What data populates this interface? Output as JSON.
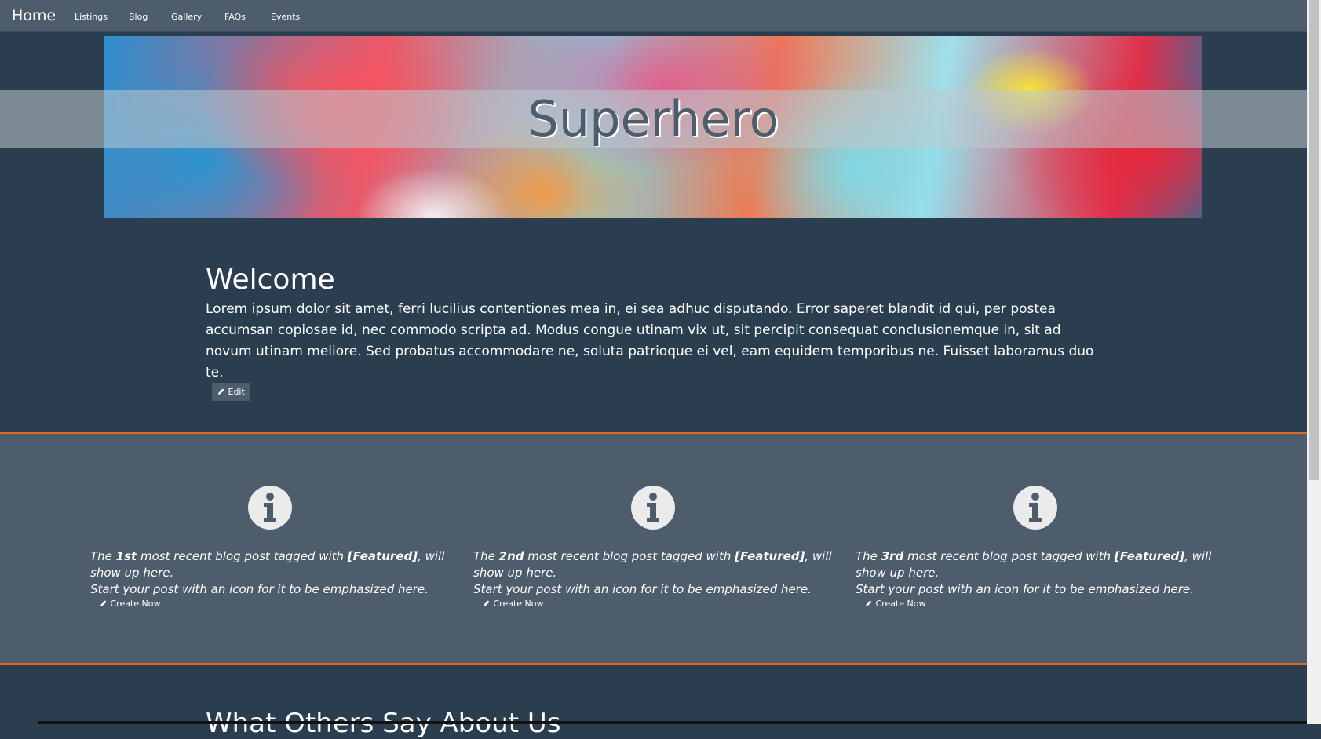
{
  "nav": {
    "brand": "Home",
    "items": [
      {
        "label": "Listings"
      },
      {
        "label": "Blog"
      },
      {
        "label": "Gallery"
      },
      {
        "label": "FAQs"
      },
      {
        "label": "Events"
      }
    ]
  },
  "hero": {
    "title": "Superhero"
  },
  "welcome": {
    "title": "Welcome",
    "body": "Lorem ipsum dolor sit amet, ferri lucilius contentiones mea in, ei sea adhuc disputando. Error saperet blandit id qui, per postea accumsan copiosae id, nec commodo scripta ad. Modus congue utinam vix ut, sit percipit consequat conclusionemque in, sit ad novum utinam meliore. Sed probatus accommodare ne, soluta patrioque ei vel, eam equidem temporibus ne. Fuisset laboramus duo te.",
    "edit_label": "Edit"
  },
  "features": [
    {
      "icon": "info-icon",
      "text_pre": "The ",
      "ordinal": "1st",
      "text_mid": " most recent blog post tagged with ",
      "tag": "[Featured]",
      "text_post": ", will show up here.",
      "text_line2": "Start your post with an icon for it to be emphasized here.",
      "link_label": "Create Now"
    },
    {
      "icon": "info-icon",
      "text_pre": "The ",
      "ordinal": "2nd",
      "text_mid": " most recent blog post tagged with ",
      "tag": "[Featured]",
      "text_post": ", will show up here.",
      "text_line2": "Start your post with an icon for it to be emphasized here.",
      "link_label": "Create Now"
    },
    {
      "icon": "info-icon",
      "text_pre": "The ",
      "ordinal": "3rd",
      "text_mid": " most recent blog post tagged with ",
      "tag": "[Featured]",
      "text_post": ", will show up here.",
      "text_line2": "Start your post with an icon for it to be emphasized here.",
      "link_label": "Create Now"
    }
  ],
  "testimonials": {
    "title": "What Others Say About Us"
  },
  "colors": {
    "background": "#2b3e50",
    "navbar": "#4e5d6c",
    "accent": "#df691a"
  }
}
